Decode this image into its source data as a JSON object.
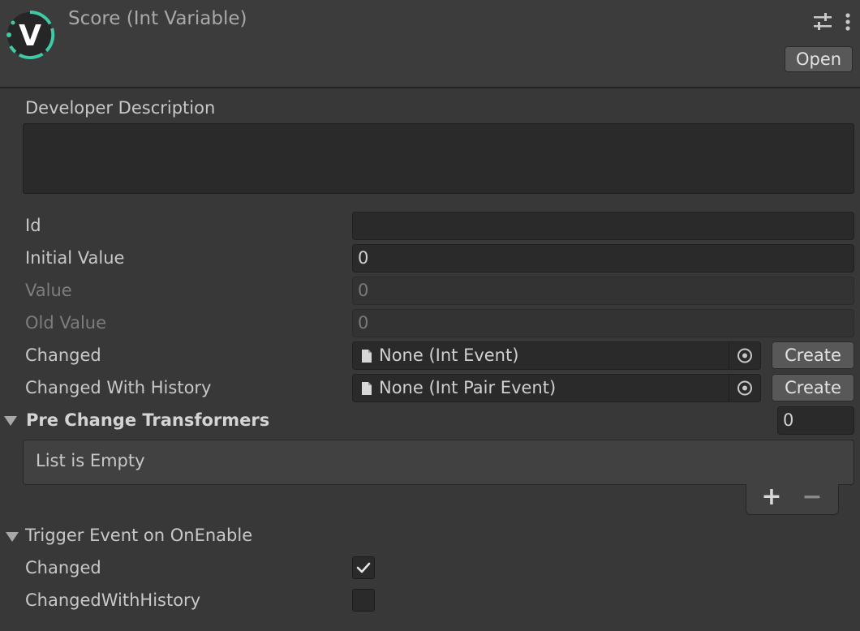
{
  "header": {
    "title": "Score (Int Variable)",
    "open_label": "Open",
    "logo_letter": "V",
    "logo_color": "#3ec9a7"
  },
  "description": {
    "label": "Developer Description",
    "value": ""
  },
  "fields": {
    "id_label": "Id",
    "id_value": "",
    "initial_value_label": "Initial Value",
    "initial_value": "0",
    "value_label": "Value",
    "value": "0",
    "old_value_label": "Old Value",
    "old_value": "0",
    "changed_label": "Changed",
    "changed_value": "None (Int Event)",
    "changed_history_label": "Changed With History",
    "changed_history_value": "None (Int Pair Event)",
    "create_label": "Create"
  },
  "pre_change": {
    "label": "Pre Change Transformers",
    "count": "0",
    "empty_text": "List is Empty",
    "add_symbol": "+",
    "remove_symbol": "−"
  },
  "trigger": {
    "label": "Trigger Event on OnEnable",
    "changed_label": "Changed",
    "changed_checked": true,
    "changed_history_label": "ChangedWithHistory",
    "changed_history_checked": false
  },
  "icons": {
    "settings": "sliders-icon",
    "more": "vertical-ellipsis-icon",
    "document": "document-icon",
    "picker": "object-picker-icon",
    "foldout": "triangle-down-icon",
    "check": "checkmark-icon"
  }
}
